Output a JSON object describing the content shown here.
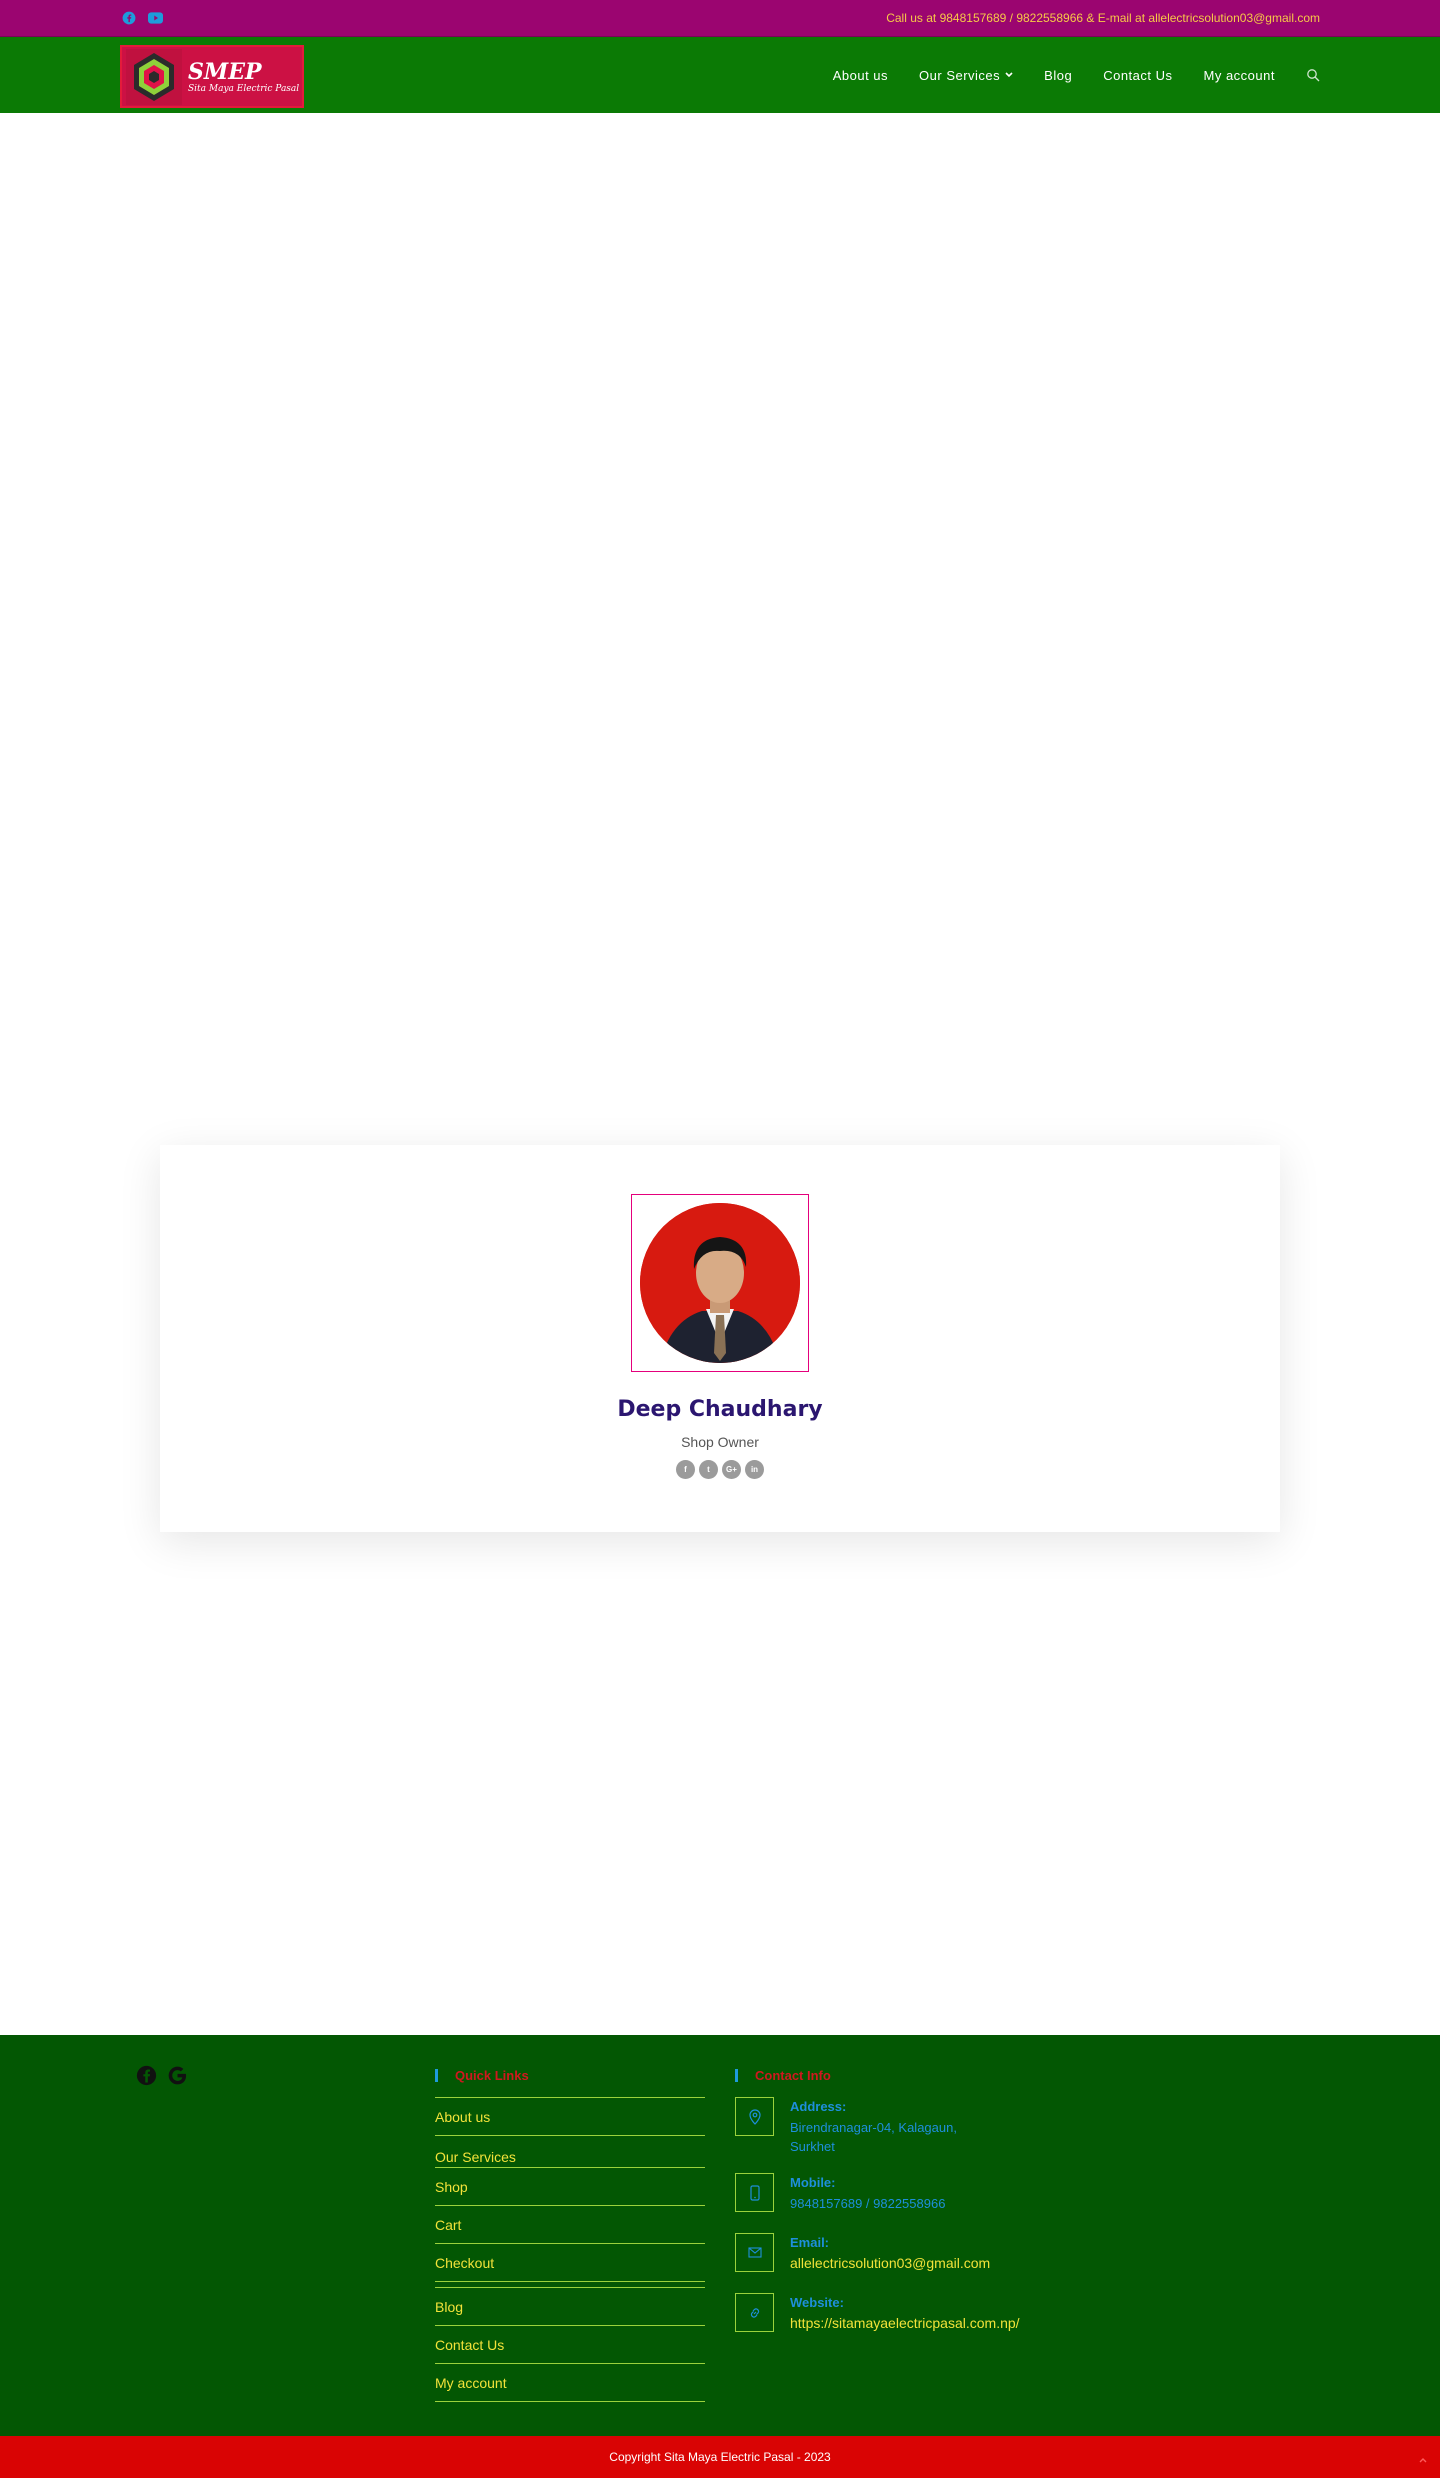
{
  "topbar": {
    "social_icons": [
      "facebook-icon",
      "youtube-icon"
    ],
    "contact_text": "Call us at 9848157689 / 9822558966 & E-mail at allelectricsolution03@gmail.com"
  },
  "header": {
    "logo": {
      "brand": "SMEP",
      "tagline": "Sita Maya Electric Pasal"
    },
    "nav": [
      {
        "label": "About us"
      },
      {
        "label": "Our Services",
        "has_dropdown": true
      },
      {
        "label": "Blog"
      },
      {
        "label": "Contact Us"
      },
      {
        "label": "My account"
      }
    ],
    "search_icon": "search-icon"
  },
  "team": {
    "name": "Deep Chaudhary",
    "role": "Shop Owner",
    "social": [
      "f",
      "t",
      "G+",
      "in"
    ]
  },
  "footer": {
    "social_icons": [
      "facebook-icon",
      "google-icon"
    ],
    "quick_links_title": "Quick Links",
    "quick_links": [
      "About us",
      "Our Services",
      "Shop",
      "Cart",
      "Checkout",
      "Blog",
      "Contact Us",
      "My account"
    ],
    "contact_title": "Contact Info",
    "contact": {
      "address_label": "Address:",
      "address_value": "Birendranagar-04, Kalagaun, Surkhet",
      "mobile_label": "Mobile:",
      "mobile_value": "9848157689 / 9822558966",
      "email_label": "Email:",
      "email_value": "allelectricsolution03@gmail.com",
      "website_label": "Website:",
      "website_value": "https://sitamayaelectricpasal.com.np/"
    },
    "copyright": "Copyright Sita Maya Electric Pasal - 2023"
  },
  "colors": {
    "topbar_bg": "#9b0570",
    "header_bg": "#0b7a05",
    "footer_bg": "#035703",
    "bottombar_bg": "#d90404",
    "accent_yellow": "#f2e23a",
    "accent_blue": "#1e8fdb",
    "name_color": "#2b1670"
  }
}
